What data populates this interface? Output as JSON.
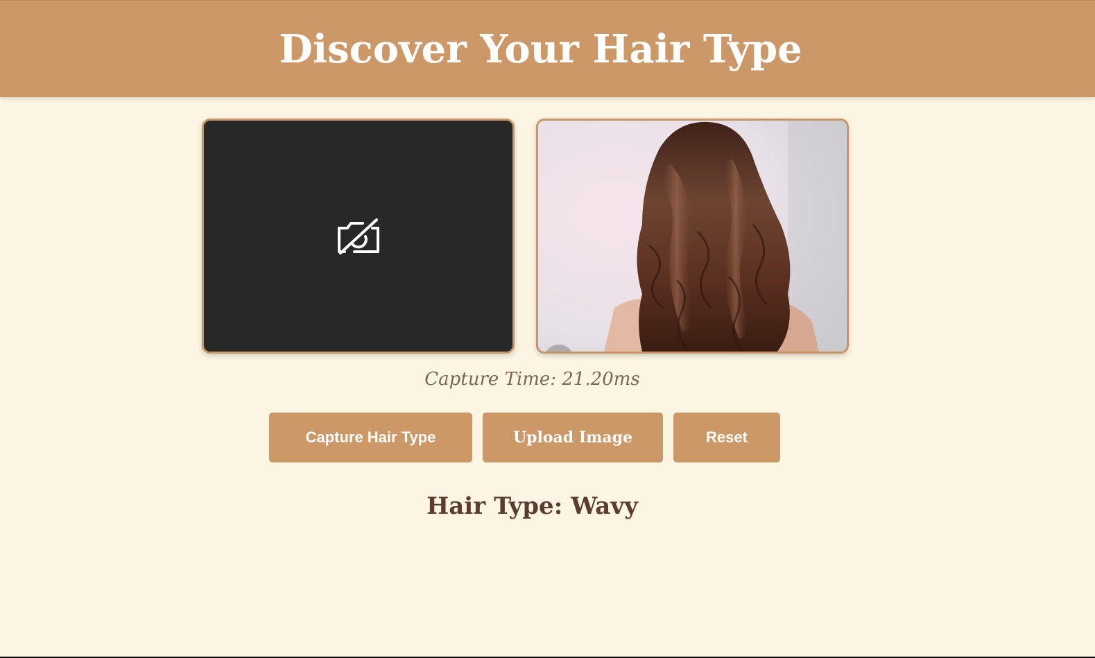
{
  "header": {
    "title": "Discover Your Hair Type"
  },
  "camera_panel": {
    "icon": "camera-off-icon",
    "background": "#282828"
  },
  "preview_panel": {
    "image": "wavy-hair-photo"
  },
  "status": {
    "capture_time": "Capture Time: 21.20ms"
  },
  "buttons": {
    "capture_label": "Capture Hair Type",
    "upload_label": "Upload Image",
    "reset_label": "Reset"
  },
  "result": {
    "hair_type": "Hair Type: Wavy"
  },
  "colors": {
    "accent": "#cc9867",
    "background": "#fdf5e4",
    "result_text": "#5a3d2e"
  }
}
